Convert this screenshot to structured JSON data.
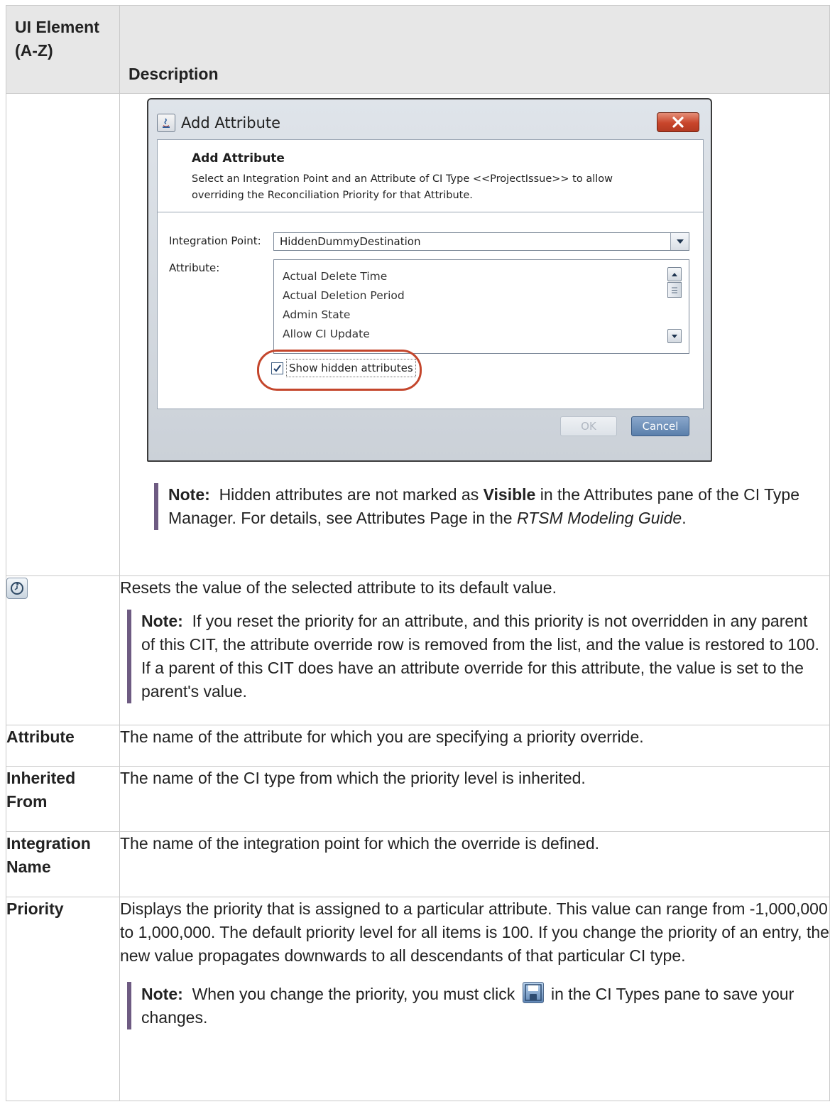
{
  "table": {
    "header": {
      "col1": "UI Element (A-Z)",
      "col2": "Description"
    }
  },
  "dialog": {
    "window_title": "Add Attribute",
    "header_title": "Add Attribute",
    "header_desc": "Select an Integration Point and an Attribute of CI Type <<ProjectIssue>> to allow overriding the Reconciliation Priority for that Attribute.",
    "integration_point_label": "Integration Point:",
    "integration_point_value": "HiddenDummyDestination",
    "attribute_label": "Attribute:",
    "attribute_items": [
      "Actual Delete Time",
      "Actual Deletion Period",
      "Admin State",
      "Allow CI Update"
    ],
    "show_hidden_label": "Show hidden attributes",
    "show_hidden_checked": true,
    "ok_label": "OK",
    "cancel_label": "Cancel"
  },
  "rows": {
    "dialog_note": {
      "label": "Note:",
      "t1": "Hidden attributes are not marked as",
      "visible": "Visible",
      "t2": "in the Attributes pane of the CI Type Manager. For details, see Attributes Page in the",
      "guide": "RTSM Modeling Guide",
      "t3": "."
    },
    "reset": {
      "icon": "reset-icon",
      "desc": "Resets the value of the selected attribute to its default value.",
      "note_label": "Note:",
      "note_text": "If you reset the priority for an attribute, and this priority is not overridden in any parent of this CIT, the attribute override row is removed from the list, and the value is restored to 100. If a parent of this CIT does have an attribute override for this attribute, the value is set to the parent's value."
    },
    "attribute": {
      "label": "Attribute",
      "desc": "The name of the attribute for which you are specifying a priority override."
    },
    "inherited": {
      "label": "Inherited From",
      "desc": "The name of the CI type from which the priority level is inherited."
    },
    "integration": {
      "label": "Integration Name",
      "desc": "The name of the integration point for which the override is defined."
    },
    "priority": {
      "label": "Priority",
      "desc": "Displays the priority that is assigned to a particular attribute. This value can range from -1,000,000 to 1,000,000. The default priority level for all items is 100. If you change the priority of an entry, the new value propagates downwards to all descendants of that particular CI type.",
      "note_label": "Note:",
      "note_t1": "When you change the priority, you must click",
      "note_t2": "in the CI Types pane to save your changes.",
      "save_icon": "save-icon"
    }
  }
}
